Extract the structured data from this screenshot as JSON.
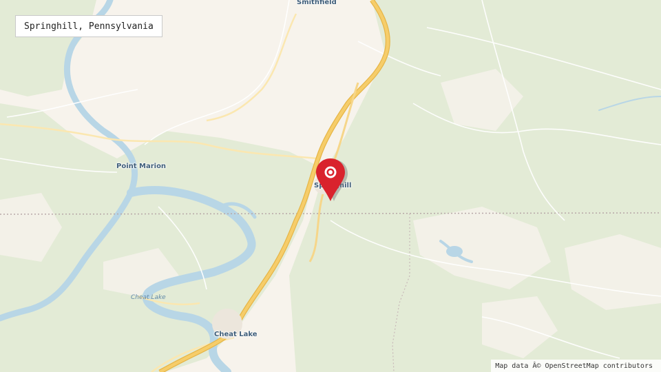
{
  "map": {
    "title": "Springhill, Pennsylvania",
    "attribution": "Map data Â© OpenStreetMap contributors",
    "marker": {
      "icon": "map-pin-icon",
      "color": "#d9232d",
      "label": "Springhill"
    },
    "places": [
      {
        "name": "Smithfield",
        "type": "town"
      },
      {
        "name": "Point Marion",
        "type": "town"
      },
      {
        "name": "Springhill",
        "type": "town"
      },
      {
        "name": "Cheat Lake",
        "type": "town"
      }
    ],
    "water_labels": [
      {
        "name": "Cheat Lake"
      }
    ],
    "colors": {
      "land": "#f7f3ec",
      "forest": "#e3ebd6",
      "water": "#b8d6e6",
      "highway": "#f6cd6a",
      "border": "#b7a7a7"
    }
  }
}
